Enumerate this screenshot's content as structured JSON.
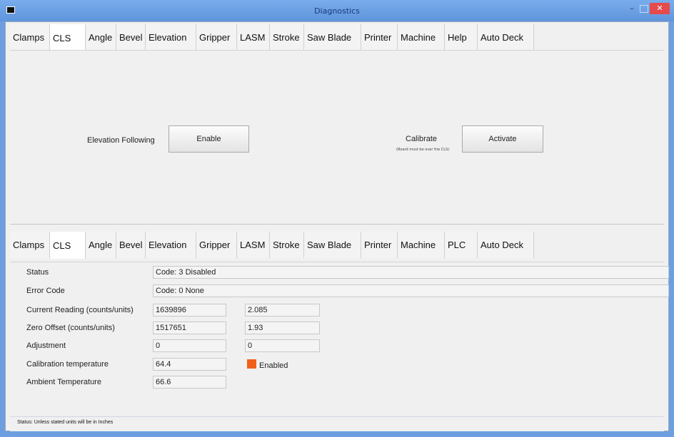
{
  "window": {
    "title": "Diagnostics"
  },
  "top_tabs": [
    "Clamps",
    "CLS",
    "Angle",
    "Bevel",
    "Elevation",
    "Gripper",
    "LASM",
    "Stroke",
    "Saw Blade",
    "Printer",
    "Machine",
    "Help",
    "Auto Deck"
  ],
  "top_panel": {
    "elevation_following_label": "Elevation Following",
    "enable_button": "Enable",
    "calibrate_label": "Calibrate",
    "calibrate_note": "(Board must be over the CLS)",
    "activate_button": "Activate"
  },
  "bottom_tabs": [
    "Clamps",
    "CLS",
    "Angle",
    "Bevel",
    "Elevation",
    "Gripper",
    "LASM",
    "Stroke",
    "Saw Blade",
    "Printer",
    "Machine",
    "PLC",
    "Auto Deck"
  ],
  "status_panel": {
    "status_label": "Status",
    "status_value": "Code: 3 Disabled",
    "error_label": "Error Code",
    "error_value": "Code: 0 None",
    "current_reading_label": "Current Reading (counts/units)",
    "current_reading_counts": "1639896",
    "current_reading_units": "2.085",
    "zero_offset_label": "Zero Offset (counts/units)",
    "zero_offset_counts": "1517651",
    "zero_offset_units": "1.93",
    "adjustment_label": "Adjustment",
    "adjustment_counts": "0",
    "adjustment_units": "0",
    "calibration_temp_label": "Calibration temperature",
    "calibration_temp_value": "64.4",
    "enabled_label": "Enabled",
    "ambient_temp_label": "Ambient Temperature",
    "ambient_temp_value": "66.6"
  },
  "statusbar": {
    "text": "Status:   Unless stated units will be in Inches"
  },
  "colors": {
    "indicator": "#f06018",
    "titlebar": "#6d9fe0",
    "close": "#e64b4b"
  }
}
